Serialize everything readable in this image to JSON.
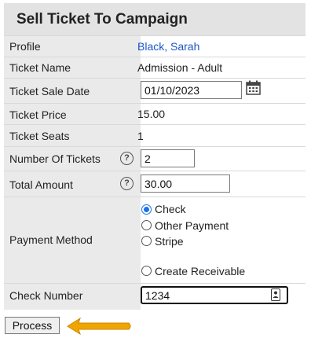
{
  "title": "Sell Ticket To Campaign",
  "fields": {
    "profile_label": "Profile",
    "profile_value": "Black, Sarah",
    "ticket_name_label": "Ticket Name",
    "ticket_name_value": "Admission - Adult",
    "sale_date_label": "Ticket Sale Date",
    "sale_date_value": "01/10/2023",
    "price_label": "Ticket Price",
    "price_value": "15.00",
    "seats_label": "Ticket Seats",
    "seats_value": "1",
    "num_tickets_label": "Number Of Tickets",
    "num_tickets_value": "2",
    "total_label": "Total Amount",
    "total_value": "30.00",
    "payment_label": "Payment Method",
    "payment_options": [
      "Check",
      "Other Payment",
      "Stripe",
      "Create Receivable"
    ],
    "payment_selected": "Check",
    "check_number_label": "Check Number",
    "check_number_value": "1234"
  },
  "help_glyph": "?",
  "process_label": "Process",
  "colors": {
    "link": "#1a56c4",
    "accent": "#1a73e8",
    "arrow": "#f0a500",
    "panel": "#e8e8e8"
  },
  "icons": [
    "calendar-icon",
    "help-icon",
    "contact-card-icon",
    "arrow-left-icon"
  ]
}
